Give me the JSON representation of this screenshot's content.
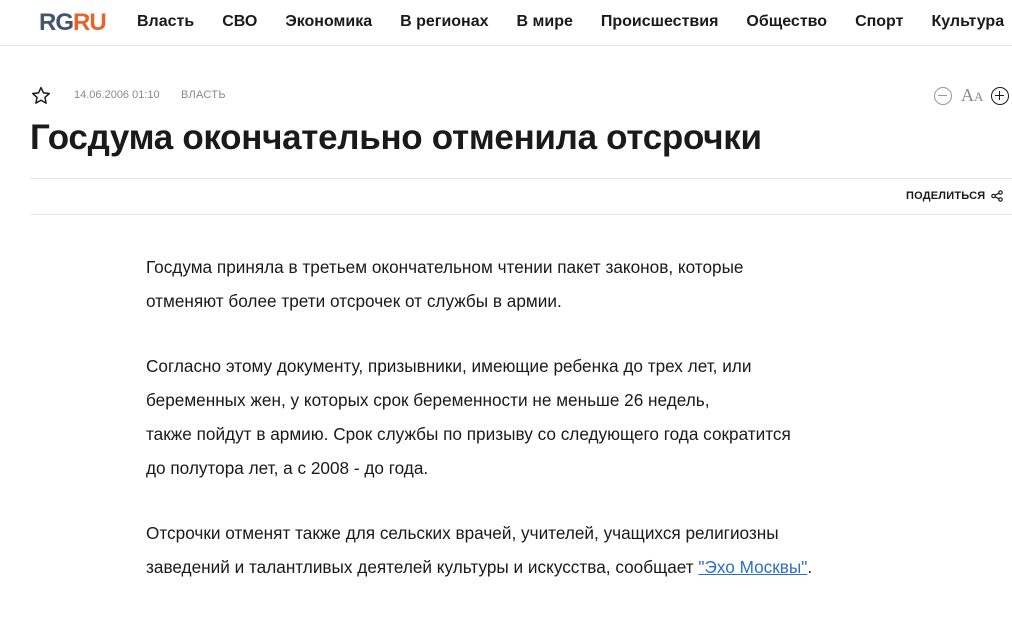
{
  "header": {
    "logo_rg": "RG",
    "logo_ru": "RU",
    "nav": [
      "Власть",
      "СВО",
      "Экономика",
      "В регионах",
      "В мире",
      "Происшествия",
      "Общество",
      "Спорт",
      "Культура"
    ]
  },
  "meta": {
    "date": "14.06.2006 01:10",
    "rubric": "ВЛАСТЬ"
  },
  "font_control": {
    "label_big": "A",
    "label_small": "A"
  },
  "article": {
    "title": "Госдума окончательно отменила отсрочки",
    "share_label": "ПОДЕЛИТЬСЯ",
    "p1": "Госдума приняла в третьем окончательном чтении пакет законов, которые\nотменяют более трети отсрочек от службы в армии.",
    "p2": "Согласно этому документу, призывники, имеющие ребенка до трех лет, или\nбеременных жен, у которых срок беременности не меньше 26 недель,\nтакже пойдут в армию. Срок службы по призыву со следующего года сократится\nдо полутора лет, а с 2008 - до года.",
    "p3_text": "Отсрочки отменят также для сельских врачей, учителей, учащихся религиозны\nзаведений и талантливых деятелей культуры и искусства, сообщает ",
    "p3_link": "\"Эхо Москвы\"",
    "p3_end": "."
  },
  "colors": {
    "logo_rg": "#44566c",
    "logo_ru": "#e8622b",
    "link": "#2a6fc9"
  }
}
